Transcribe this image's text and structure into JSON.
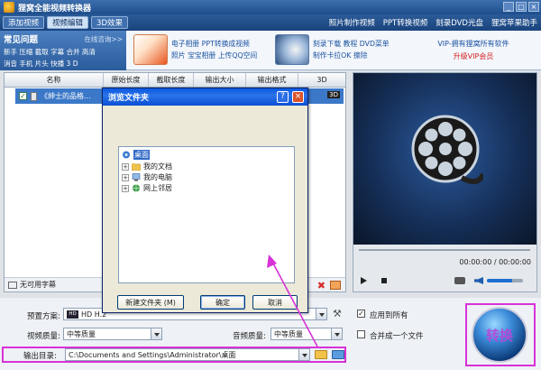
{
  "app": {
    "title": "狸窝全能视频转换器",
    "window_buttons": [
      "_",
      "□",
      "×"
    ]
  },
  "toolbar": {
    "tabs": [
      {
        "label": "添加视频"
      },
      {
        "label": "视频编辑"
      },
      {
        "label": "3D效果"
      }
    ],
    "links": [
      "照片制作视频",
      "PPT转换视频",
      "刻录DVD光盘",
      "狸窝苹果助手"
    ]
  },
  "promo": {
    "faq_title": "常见问题",
    "faq_online": "在线咨询>>",
    "faq_row1": "新手 压缩 截取 字幕 合并 高清",
    "faq_row2": "消音 手机 片头 快播 3 D",
    "block1_line1": "电子相册 PPT转换成视频",
    "block1_line2": "照片 宝宝相册 上传QQ空间",
    "block2_line1": "刻录下载 教程 DVD菜单",
    "block2_line2": "制作卡拉OK 擦除",
    "vip_line": "VIP-拥有狸窝所有软件",
    "vip_link": "升级VIP会员"
  },
  "file_list": {
    "columns": [
      "名称",
      "原始长度",
      "截取长度",
      "输出大小",
      "输出格式",
      "3D"
    ],
    "rows": [
      {
        "name": "《绅士的品格...",
        "badge": "3D"
      }
    ],
    "subtitle": "无可用字幕"
  },
  "preview": {
    "time": "00:00:00 / 00:00:00"
  },
  "settings": {
    "preset_label": "预置方案:",
    "preset_value": "HD H.2",
    "video_quality_label": "视频质量:",
    "video_quality_value": "中等质量",
    "audio_quality_label": "音频质量:",
    "audio_quality_value": "中等质量",
    "output_label": "输出目录:",
    "output_path": "C:\\Documents and Settings\\Administrator\\桌面",
    "apply_all": "应用到所有",
    "merge_one": "合并成一个文件",
    "convert": "转换"
  },
  "dialog": {
    "title": "浏览文件夹",
    "help": "?",
    "close": "×",
    "tree": [
      {
        "label": "桌面",
        "selected": true
      },
      {
        "label": "我的文档"
      },
      {
        "label": "我的电脑"
      },
      {
        "label": "网上邻居"
      }
    ],
    "new_folder": "新建文件夹 (M)",
    "ok": "确定",
    "cancel": "取消"
  },
  "colors": {
    "titlebar": "#1f4e8c",
    "selection": "#3c78c8",
    "highlight_frame": "#d832d8",
    "vip_red": "#d42020"
  }
}
